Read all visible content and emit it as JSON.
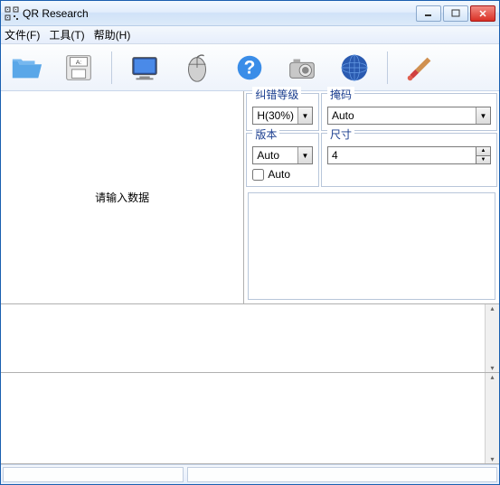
{
  "window": {
    "title": "QR Research"
  },
  "menu": {
    "file": "文件(F)",
    "tools": "工具(T)",
    "help": "帮助(H)"
  },
  "canvas": {
    "placeholder": "请输入数据"
  },
  "settings": {
    "errorCorrection": {
      "label": "纠错等级",
      "value": "H(30%)"
    },
    "mask": {
      "label": "掩码",
      "value": "Auto"
    },
    "version": {
      "label": "版本",
      "value": "Auto",
      "autoCheckbox": "Auto"
    },
    "size": {
      "label": "尺寸",
      "value": "4"
    }
  },
  "textarea1": "",
  "textarea2": ""
}
